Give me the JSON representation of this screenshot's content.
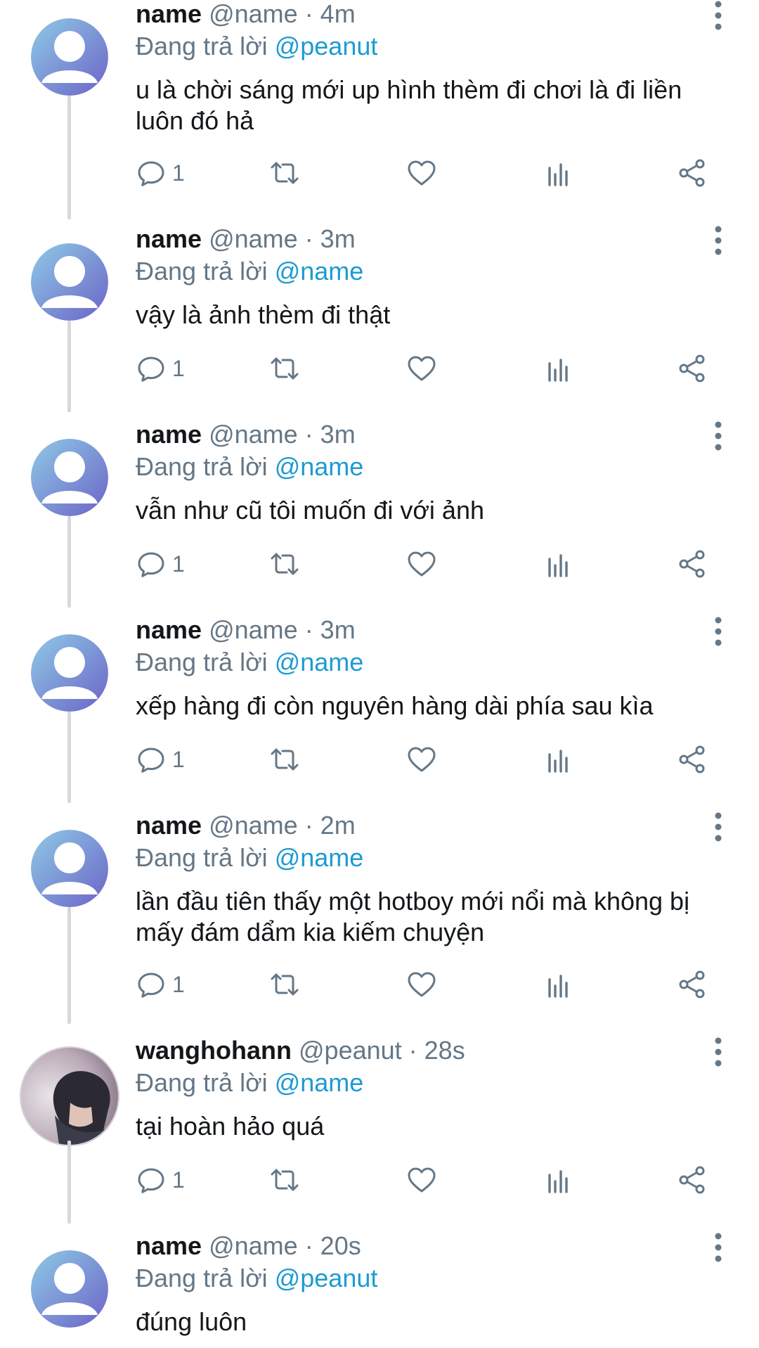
{
  "tweets": [
    {
      "name": "name",
      "handle": "@name",
      "time": "· 4m",
      "reply_prefix": "Đang trả lời",
      "reply_to": "@peanut",
      "text": "u là chời sáng mới up hình thèm đi chơi là đi liền luôn đó hả",
      "reply_count": "1",
      "avatar": "default-avatar"
    },
    {
      "name": "name",
      "handle": "@name",
      "time": "· 3m",
      "reply_prefix": "Đang trả lời",
      "reply_to": "@name",
      "text": "vậy là ảnh thèm đi thật",
      "reply_count": "1",
      "avatar": "default-avatar"
    },
    {
      "name": "name",
      "handle": "@name",
      "time": "· 3m",
      "reply_prefix": "Đang trả lời",
      "reply_to": "@name",
      "text": "vẫn như cũ tôi muốn đi với ảnh",
      "reply_count": "1",
      "avatar": "default-avatar"
    },
    {
      "name": "name",
      "handle": "@name",
      "time": "· 3m",
      "reply_prefix": "Đang trả lời",
      "reply_to": "@name",
      "text": "xếp hàng đi còn nguyên hàng dài phía sau kìa",
      "reply_count": "1",
      "avatar": "default-avatar"
    },
    {
      "name": "name",
      "handle": "@name",
      "time": "· 2m",
      "reply_prefix": "Đang trả lời",
      "reply_to": "@name",
      "text": "lần đầu tiên thấy một hotboy mới nổi mà không bị mấy đám dẩm kia kiếm chuyện",
      "reply_count": "1",
      "avatar": "default-avatar"
    },
    {
      "name": "wanghohann",
      "handle": "@peanut",
      "time": "· 28s",
      "reply_prefix": "Đang trả lời",
      "reply_to": "@name",
      "text": "tại hoàn hảo quá",
      "reply_count": "1",
      "avatar": "photo-avatar"
    },
    {
      "name": "name",
      "handle": "@name",
      "time": "· 20s",
      "reply_prefix": "Đang trả lời",
      "reply_to": "@peanut",
      "text": "đúng luôn",
      "reply_count": "",
      "avatar": "default-avatar"
    }
  ],
  "colors": {
    "mention": "#1d9bd1",
    "meta": "#657786",
    "icon": "#657786",
    "thread_line": "#d5d9dc",
    "avatar_gradient_start": "#8ecae6",
    "avatar_gradient_end": "#6c63c7"
  },
  "icons": {
    "reply": "reply-icon",
    "retweet": "retweet-icon",
    "like": "heart-icon",
    "stats": "stats-icon",
    "share": "share-icon",
    "more": "more-vertical-icon"
  }
}
